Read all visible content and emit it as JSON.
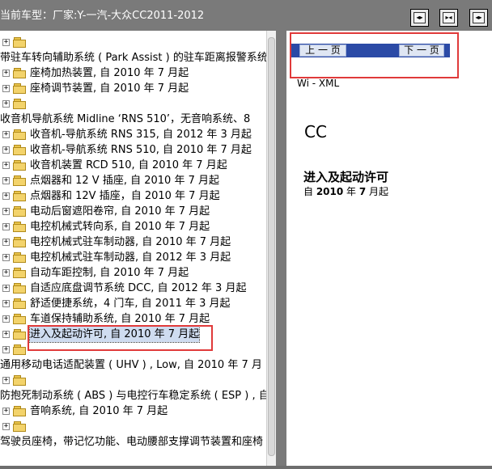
{
  "window": {
    "title": "当前车型：厂家:Y-一汽-大众CC2011-2012"
  },
  "toolbar": {
    "buttons": [
      {
        "name": "toolbar-button-1",
        "glyph": "◂▸"
      },
      {
        "name": "toolbar-button-2",
        "glyph": "▸◂"
      },
      {
        "name": "toolbar-button-3",
        "glyph": "◂▸"
      }
    ]
  },
  "tree": {
    "items": [
      {
        "label": "",
        "type": "node"
      },
      {
        "label": "带驻车转向辅助系统 ( Park Assist ) 的驻车距离报警系统",
        "type": "text"
      },
      {
        "label": "座椅加热装置, 自 2010 年 7 月起",
        "type": "node"
      },
      {
        "label": "座椅调节装置, 自 2010 年 7 月起",
        "type": "node"
      },
      {
        "label": "",
        "type": "node"
      },
      {
        "label": "收音机导航系统 Midline ‘RNS 510’，无音响系统、8",
        "type": "text"
      },
      {
        "label": "收音机-导航系统 RNS 315, 自 2012 年 3 月起",
        "type": "node"
      },
      {
        "label": "收音机-导航系统 RNS 510, 自 2010 年 7 月起",
        "type": "node"
      },
      {
        "label": "收音机装置 RCD 510, 自 2010 年 7 月起",
        "type": "node"
      },
      {
        "label": "点烟器和 12 V 插座, 自 2010 年 7 月起",
        "type": "node"
      },
      {
        "label": "点烟器和 12V 插座，自 2010 年 7 月起",
        "type": "node"
      },
      {
        "label": "电动后窗遮阳卷帘, 自 2010 年 7 月起",
        "type": "node"
      },
      {
        "label": "电控机械式转向系, 自 2010 年 7 月起",
        "type": "node"
      },
      {
        "label": "电控机械式驻车制动器, 自 2010 年 7 月起",
        "type": "node"
      },
      {
        "label": "电控机械式驻车制动器, 自 2012 年 3 月起",
        "type": "node"
      },
      {
        "label": "自动车距控制, 自 2010 年 7 月起",
        "type": "node"
      },
      {
        "label": "自适应底盘调节系统 DCC, 自 2012 年 3 月起",
        "type": "node"
      },
      {
        "label": "舒适便捷系统，4 门车, 自 2011 年 3 月起",
        "type": "node"
      },
      {
        "label": "车道保持辅助系统, 自 2010 年 7 月起",
        "type": "node"
      },
      {
        "label": "进入及起动许可, 自 2010 年 7 月起",
        "type": "node",
        "selected": true
      },
      {
        "label": "",
        "type": "node"
      },
      {
        "label": "通用移动电话适配装置 ( UHV ) , Low, 自 2010 年 7 月",
        "type": "text"
      },
      {
        "label": "",
        "type": "node"
      },
      {
        "label": "防抱死制动系统 ( ABS ) 与电控行车稳定系统 ( ESP ) , 自",
        "type": "text"
      },
      {
        "label": "音响系统, 自 2010 年 7 月起",
        "type": "node"
      },
      {
        "label": "",
        "type": "node"
      },
      {
        "label": "驾驶员座椅，带记忆功能、电动腰部支撑调节装置和座椅",
        "type": "text"
      }
    ]
  },
  "nav": {
    "prev_label": "上 一 页",
    "next_label": "下 一 页"
  },
  "document": {
    "source": "Wi - XML",
    "model": "CC",
    "heading": "进入及起动许可",
    "sub_prefix": "自 ",
    "sub_year": "2010",
    "sub_mid": " 年 ",
    "sub_month": "7",
    "sub_suffix": " 月起"
  },
  "colors": {
    "titlebar": "#7a7a7a",
    "nav_bar": "#2b4aa6",
    "highlight_border": "#e03a3a",
    "selection": "#cfdcf0"
  }
}
